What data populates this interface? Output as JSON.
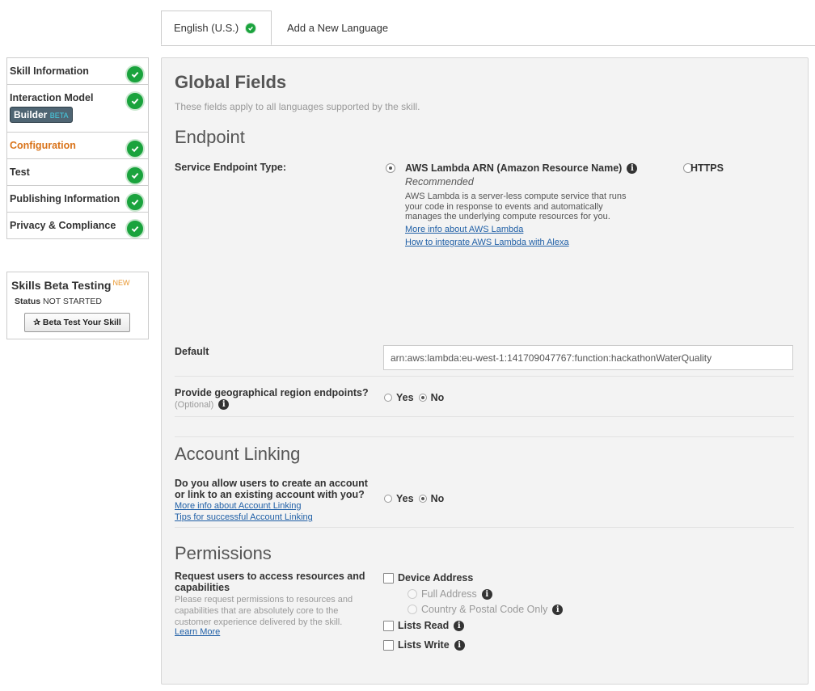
{
  "tabs": {
    "active_label": "English (U.S.)",
    "add_label": "Add a New Language"
  },
  "sidebar": {
    "items": [
      {
        "label": "Skill Information"
      },
      {
        "label": "Interaction Model",
        "badge": "Builder",
        "badge_suffix": "BETA"
      },
      {
        "label": "Configuration"
      },
      {
        "label": "Test"
      },
      {
        "label": "Publishing Information"
      },
      {
        "label": "Privacy & Compliance"
      }
    ]
  },
  "beta_testing": {
    "title": "Skills Beta Testing",
    "new_badge": "NEW",
    "status_label": "Status",
    "status_value": "NOT STARTED",
    "button_label": "✰ Beta Test Your Skill"
  },
  "global": {
    "title": "Global Fields",
    "subtitle": "These fields apply to all languages supported by the skill."
  },
  "endpoint": {
    "title": "Endpoint",
    "type_label": "Service Endpoint Type:",
    "lambda_label": "AWS Lambda ARN (Amazon Resource Name)",
    "recommended": "Recommended",
    "lambda_desc": "AWS Lambda is a server-less compute service that runs your code in response to events and automatically manages the underlying compute resources for you.",
    "link_more": "More info about AWS Lambda",
    "link_integrate": "How to integrate AWS Lambda with Alexa",
    "https_label": "HTTPS",
    "selected": "lambda",
    "default_label": "Default",
    "default_value": "arn:aws:lambda:eu-west-1:141709047767:function:hackathonWaterQuality",
    "geo_label": "Provide geographical region endpoints?",
    "geo_hint": "(Optional)",
    "yes": "Yes",
    "no": "No",
    "geo_selected": "No"
  },
  "account_linking": {
    "title": "Account Linking",
    "question": "Do you allow users to create an account or link to an existing account with you?",
    "link_more": "More info about Account Linking",
    "link_tips": "Tips for successful Account Linking",
    "yes": "Yes",
    "no": "No",
    "selected": "No"
  },
  "permissions": {
    "title": "Permissions",
    "request_label": "Request users to access resources and capabilities",
    "request_desc": "Please request permissions to resources and capabilities that are absolutely core to the customer experience delivered by the skill.",
    "learn_more": "Learn More",
    "device_address": "Device Address",
    "full_address": "Full Address",
    "country_postal": "Country & Postal Code Only",
    "lists_read": "Lists Read",
    "lists_write": "Lists Write"
  },
  "colors": {
    "check_green": "#1aa33d",
    "active_orange": "#d9731a",
    "link_blue": "#1f5fa6",
    "panel_bg": "#f3f3f3"
  }
}
